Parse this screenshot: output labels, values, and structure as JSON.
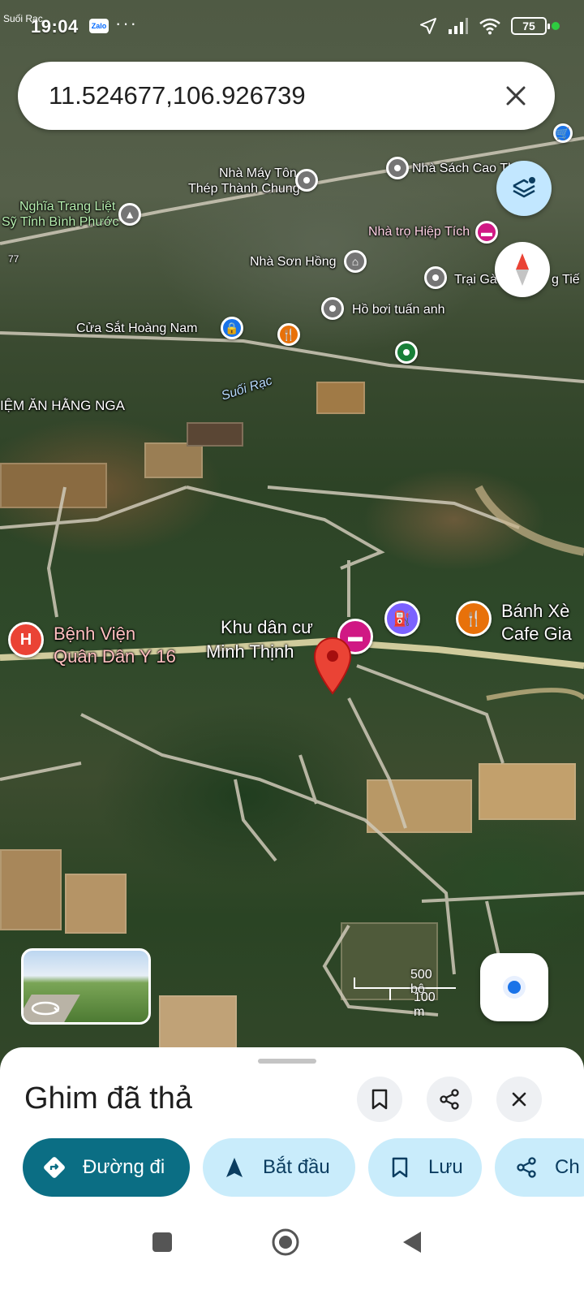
{
  "status_bar": {
    "corner_text": "Suối Rạc",
    "time": "19:04",
    "app_badge": "Zalo",
    "dots": "···",
    "battery": "75"
  },
  "search": {
    "value": "11.524677,106.926739"
  },
  "map": {
    "labels": {
      "nha_may_ton_1": "Nhà Máy Tôn",
      "nha_may_ton_2": "Thép Thành Chung",
      "nha_sach": "Nhà Sách Cao Th",
      "nghia_trang_1": "Nghĩa Trang Liệt",
      "nghia_trang_2": "Sỹ Tỉnh Bình Phước",
      "nha_tro": "Nhà trọ Hiệp Tích",
      "nha_son_hong": "Nhà Sơn Hồng",
      "trai_ga": "Trại Gà",
      "trai_ga_tail": "g Tiế",
      "ho_boi": "Hồ bơi tuấn anh",
      "cua_sat": "Cửa Sắt Hoàng Nam",
      "quan_an": "IỆM ĂN HẰNG NGA",
      "suoi_rac": "Suối Rạc",
      "road_no": "77",
      "benh_vien_1": "Bệnh Viện",
      "benh_vien_2": "Quân Dân Y 16",
      "khu_dan_cu_1": "Khu dân cư",
      "khu_dan_cu_2": "Minh Thịnh",
      "banh_xeo_1": "Bánh Xè",
      "banh_xeo_2": "Cafe Gia",
      "hospital_glyph": "H"
    },
    "scale": {
      "imperial": "500 bộ",
      "metric": "100 m"
    }
  },
  "sheet": {
    "title": "Ghim đã thả",
    "chips": [
      {
        "label": "Đường đi",
        "icon": "directions-icon"
      },
      {
        "label": "Bắt đầu",
        "icon": "navigation-arrow-icon"
      },
      {
        "label": "Lưu",
        "icon": "bookmark-icon"
      },
      {
        "label": "Ch",
        "icon": "share-icon"
      }
    ]
  },
  "colors": {
    "primary_chip": "#0b6e84",
    "secondary_chip": "#c9ecfb",
    "dropped_pin": "#ea4335",
    "layers_fab": "#c2e7ff"
  }
}
